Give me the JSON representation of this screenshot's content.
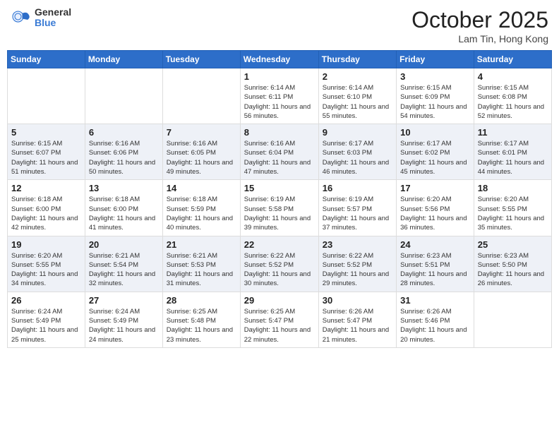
{
  "logo": {
    "general": "General",
    "blue": "Blue"
  },
  "title": "October 2025",
  "location": "Lam Tin, Hong Kong",
  "days_of_week": [
    "Sunday",
    "Monday",
    "Tuesday",
    "Wednesday",
    "Thursday",
    "Friday",
    "Saturday"
  ],
  "weeks": [
    [
      {
        "day": "",
        "sunrise": "",
        "sunset": "",
        "daylight": ""
      },
      {
        "day": "",
        "sunrise": "",
        "sunset": "",
        "daylight": ""
      },
      {
        "day": "",
        "sunrise": "",
        "sunset": "",
        "daylight": ""
      },
      {
        "day": "1",
        "sunrise": "Sunrise: 6:14 AM",
        "sunset": "Sunset: 6:11 PM",
        "daylight": "Daylight: 11 hours and 56 minutes."
      },
      {
        "day": "2",
        "sunrise": "Sunrise: 6:14 AM",
        "sunset": "Sunset: 6:10 PM",
        "daylight": "Daylight: 11 hours and 55 minutes."
      },
      {
        "day": "3",
        "sunrise": "Sunrise: 6:15 AM",
        "sunset": "Sunset: 6:09 PM",
        "daylight": "Daylight: 11 hours and 54 minutes."
      },
      {
        "day": "4",
        "sunrise": "Sunrise: 6:15 AM",
        "sunset": "Sunset: 6:08 PM",
        "daylight": "Daylight: 11 hours and 52 minutes."
      }
    ],
    [
      {
        "day": "5",
        "sunrise": "Sunrise: 6:15 AM",
        "sunset": "Sunset: 6:07 PM",
        "daylight": "Daylight: 11 hours and 51 minutes."
      },
      {
        "day": "6",
        "sunrise": "Sunrise: 6:16 AM",
        "sunset": "Sunset: 6:06 PM",
        "daylight": "Daylight: 11 hours and 50 minutes."
      },
      {
        "day": "7",
        "sunrise": "Sunrise: 6:16 AM",
        "sunset": "Sunset: 6:05 PM",
        "daylight": "Daylight: 11 hours and 49 minutes."
      },
      {
        "day": "8",
        "sunrise": "Sunrise: 6:16 AM",
        "sunset": "Sunset: 6:04 PM",
        "daylight": "Daylight: 11 hours and 47 minutes."
      },
      {
        "day": "9",
        "sunrise": "Sunrise: 6:17 AM",
        "sunset": "Sunset: 6:03 PM",
        "daylight": "Daylight: 11 hours and 46 minutes."
      },
      {
        "day": "10",
        "sunrise": "Sunrise: 6:17 AM",
        "sunset": "Sunset: 6:02 PM",
        "daylight": "Daylight: 11 hours and 45 minutes."
      },
      {
        "day": "11",
        "sunrise": "Sunrise: 6:17 AM",
        "sunset": "Sunset: 6:01 PM",
        "daylight": "Daylight: 11 hours and 44 minutes."
      }
    ],
    [
      {
        "day": "12",
        "sunrise": "Sunrise: 6:18 AM",
        "sunset": "Sunset: 6:00 PM",
        "daylight": "Daylight: 11 hours and 42 minutes."
      },
      {
        "day": "13",
        "sunrise": "Sunrise: 6:18 AM",
        "sunset": "Sunset: 6:00 PM",
        "daylight": "Daylight: 11 hours and 41 minutes."
      },
      {
        "day": "14",
        "sunrise": "Sunrise: 6:18 AM",
        "sunset": "Sunset: 5:59 PM",
        "daylight": "Daylight: 11 hours and 40 minutes."
      },
      {
        "day": "15",
        "sunrise": "Sunrise: 6:19 AM",
        "sunset": "Sunset: 5:58 PM",
        "daylight": "Daylight: 11 hours and 39 minutes."
      },
      {
        "day": "16",
        "sunrise": "Sunrise: 6:19 AM",
        "sunset": "Sunset: 5:57 PM",
        "daylight": "Daylight: 11 hours and 37 minutes."
      },
      {
        "day": "17",
        "sunrise": "Sunrise: 6:20 AM",
        "sunset": "Sunset: 5:56 PM",
        "daylight": "Daylight: 11 hours and 36 minutes."
      },
      {
        "day": "18",
        "sunrise": "Sunrise: 6:20 AM",
        "sunset": "Sunset: 5:55 PM",
        "daylight": "Daylight: 11 hours and 35 minutes."
      }
    ],
    [
      {
        "day": "19",
        "sunrise": "Sunrise: 6:20 AM",
        "sunset": "Sunset: 5:55 PM",
        "daylight": "Daylight: 11 hours and 34 minutes."
      },
      {
        "day": "20",
        "sunrise": "Sunrise: 6:21 AM",
        "sunset": "Sunset: 5:54 PM",
        "daylight": "Daylight: 11 hours and 32 minutes."
      },
      {
        "day": "21",
        "sunrise": "Sunrise: 6:21 AM",
        "sunset": "Sunset: 5:53 PM",
        "daylight": "Daylight: 11 hours and 31 minutes."
      },
      {
        "day": "22",
        "sunrise": "Sunrise: 6:22 AM",
        "sunset": "Sunset: 5:52 PM",
        "daylight": "Daylight: 11 hours and 30 minutes."
      },
      {
        "day": "23",
        "sunrise": "Sunrise: 6:22 AM",
        "sunset": "Sunset: 5:52 PM",
        "daylight": "Daylight: 11 hours and 29 minutes."
      },
      {
        "day": "24",
        "sunrise": "Sunrise: 6:23 AM",
        "sunset": "Sunset: 5:51 PM",
        "daylight": "Daylight: 11 hours and 28 minutes."
      },
      {
        "day": "25",
        "sunrise": "Sunrise: 6:23 AM",
        "sunset": "Sunset: 5:50 PM",
        "daylight": "Daylight: 11 hours and 26 minutes."
      }
    ],
    [
      {
        "day": "26",
        "sunrise": "Sunrise: 6:24 AM",
        "sunset": "Sunset: 5:49 PM",
        "daylight": "Daylight: 11 hours and 25 minutes."
      },
      {
        "day": "27",
        "sunrise": "Sunrise: 6:24 AM",
        "sunset": "Sunset: 5:49 PM",
        "daylight": "Daylight: 11 hours and 24 minutes."
      },
      {
        "day": "28",
        "sunrise": "Sunrise: 6:25 AM",
        "sunset": "Sunset: 5:48 PM",
        "daylight": "Daylight: 11 hours and 23 minutes."
      },
      {
        "day": "29",
        "sunrise": "Sunrise: 6:25 AM",
        "sunset": "Sunset: 5:47 PM",
        "daylight": "Daylight: 11 hours and 22 minutes."
      },
      {
        "day": "30",
        "sunrise": "Sunrise: 6:26 AM",
        "sunset": "Sunset: 5:47 PM",
        "daylight": "Daylight: 11 hours and 21 minutes."
      },
      {
        "day": "31",
        "sunrise": "Sunrise: 6:26 AM",
        "sunset": "Sunset: 5:46 PM",
        "daylight": "Daylight: 11 hours and 20 minutes."
      },
      {
        "day": "",
        "sunrise": "",
        "sunset": "",
        "daylight": ""
      }
    ]
  ]
}
